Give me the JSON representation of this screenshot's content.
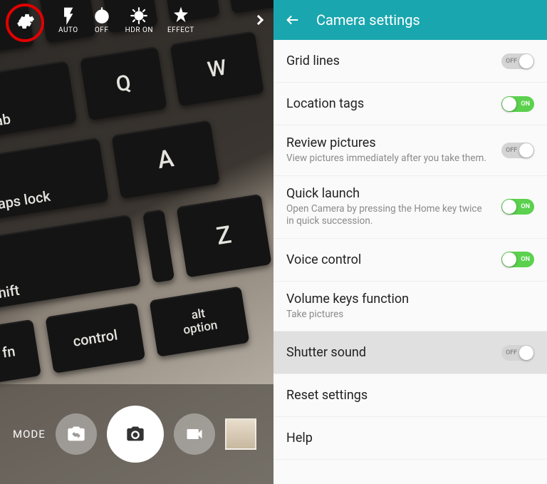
{
  "camera": {
    "toolbar": {
      "flash": "AUTO",
      "timer": "OFF",
      "hdr": "HDR ON",
      "effect": "EFFECT"
    },
    "bottom": {
      "mode": "MODE"
    }
  },
  "settings": {
    "title": "Camera settings",
    "items": [
      {
        "title": "Grid lines",
        "desc": "",
        "toggle": "off"
      },
      {
        "title": "Location tags",
        "desc": "",
        "toggle": "on"
      },
      {
        "title": "Review pictures",
        "desc": "View pictures immediately after you take them.",
        "toggle": "off"
      },
      {
        "title": "Quick launch",
        "desc": "Open Camera by pressing the Home key twice in quick succession.",
        "toggle": "on"
      },
      {
        "title": "Voice control",
        "desc": "",
        "toggle": "on"
      },
      {
        "title": "Volume keys function",
        "desc": "Take pictures",
        "toggle": ""
      },
      {
        "title": "Shutter sound",
        "desc": "",
        "toggle": "off",
        "pressed": true
      },
      {
        "title": "Reset settings",
        "desc": "",
        "toggle": ""
      },
      {
        "title": "Help",
        "desc": "",
        "toggle": ""
      }
    ],
    "toggle_labels": {
      "on": "ON",
      "off": "OFF"
    }
  },
  "preview_keys": {
    "r2": [
      "tab",
      "Q",
      "W"
    ],
    "r3": [
      "caps lock",
      "A"
    ],
    "r4": [
      "shift",
      "",
      "Z"
    ],
    "r5": [
      "fn",
      "control",
      "alt option"
    ]
  }
}
